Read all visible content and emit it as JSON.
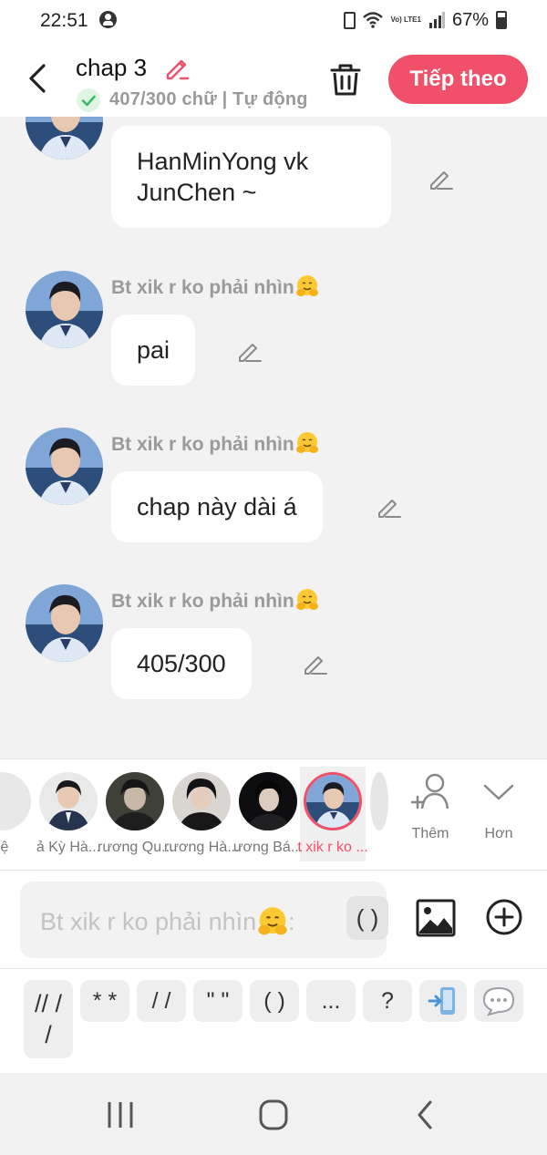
{
  "status_bar": {
    "time": "22:51",
    "battery_percent": "67%",
    "network_label": "Vo) LTE1"
  },
  "header": {
    "title": "chap 3",
    "subtitle": "407/300 chữ | Tự động",
    "next_button": "Tiếp theo",
    "accent_color": "#f0506a"
  },
  "messages": [
    {
      "sender": "",
      "text": "HanMinYong vk JunChen ~",
      "show_avatar": true
    },
    {
      "sender": "Bt xik r ko phải nhìn",
      "text": "pai"
    },
    {
      "sender": "Bt xik r ko phải nhìn",
      "text": "chap này dài á"
    },
    {
      "sender": "Bt xik r ko phải nhìn",
      "text": "405/300"
    }
  ],
  "characters": [
    {
      "label": "ệ"
    },
    {
      "label": "ả Kỳ Hà..."
    },
    {
      "label": "rương Qu..."
    },
    {
      "label": "rương Hà..."
    },
    {
      "label": "ương Bá..."
    },
    {
      "label": "t xik r ko ...",
      "selected": true
    }
  ],
  "picker_actions": {
    "add": "Thêm",
    "more": "Hơn"
  },
  "input": {
    "placeholder": "Bt xik r ko phải nhìn",
    "placeholder_suffix": ":",
    "chip": "( )"
  },
  "quick_keys": [
    "// /\n/",
    "* *",
    "/ /",
    "\" \"",
    "( )",
    "...",
    "?"
  ],
  "icons": {
    "back": "chevron-left-icon",
    "edit_title": "pencil-icon",
    "delete": "trash-icon",
    "check": "check-circle-icon",
    "edit_message": "pencil-icon",
    "add_character": "add-person-icon",
    "more": "chevron-down-icon",
    "image": "image-icon",
    "plus": "plus-circle-icon",
    "emoji": "hugging-face-emoji"
  }
}
